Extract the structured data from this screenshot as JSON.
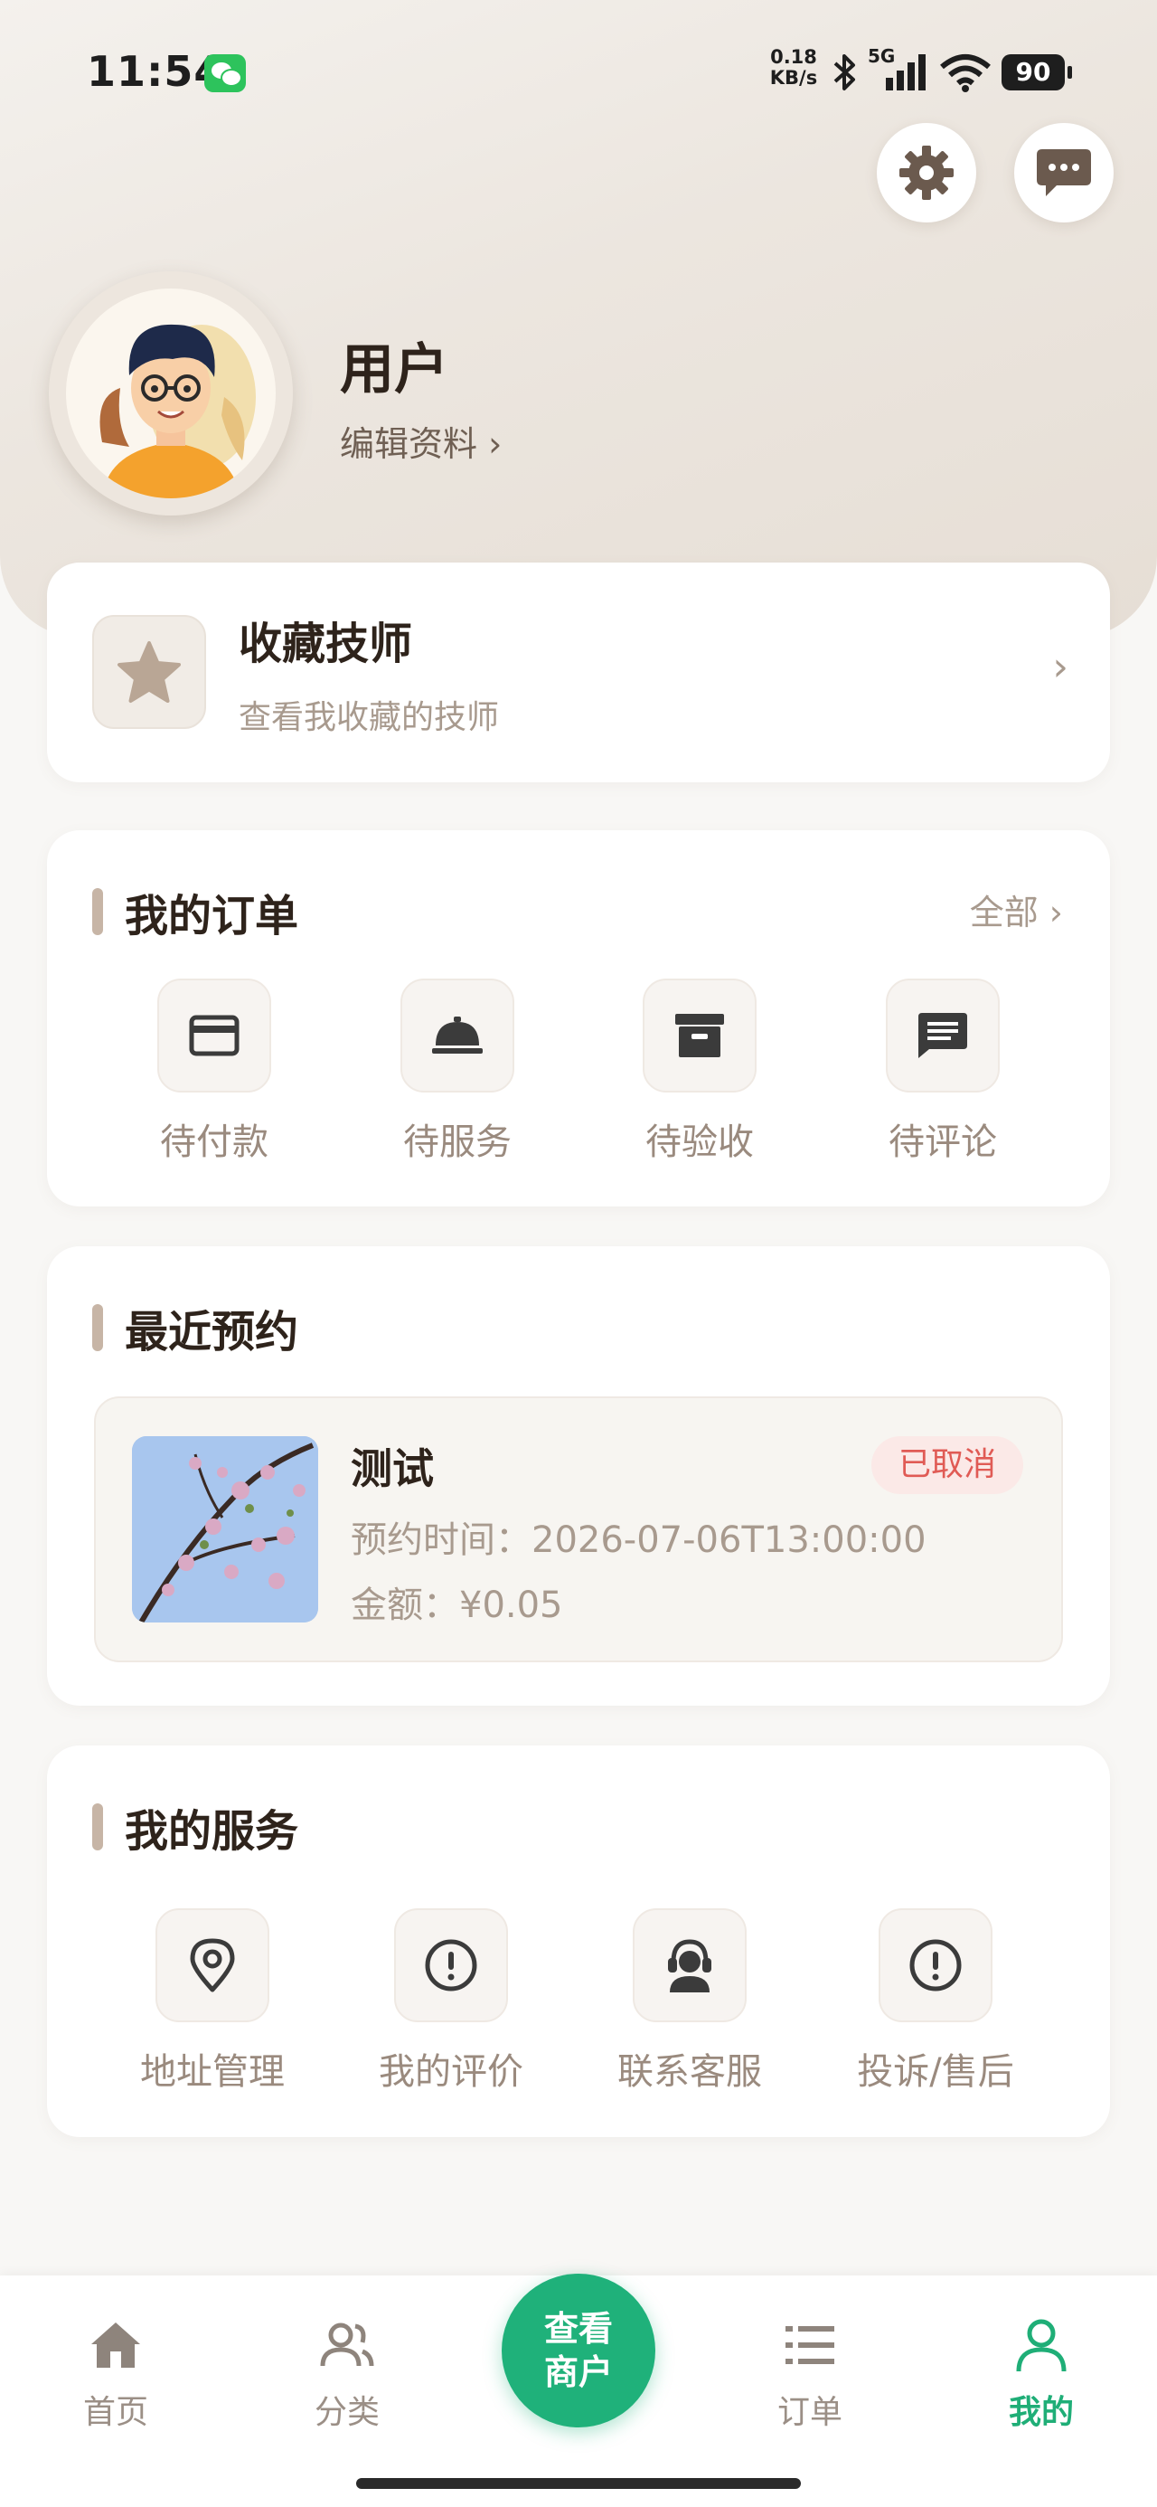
{
  "status_bar": {
    "time": "11:54",
    "net_speed_value": "0.18",
    "net_speed_unit": "KB/s",
    "network_type": "5G",
    "battery": "90"
  },
  "profile": {
    "username": "用户",
    "edit_label": "编辑资料 ›"
  },
  "favorites": {
    "title": "收藏技师",
    "subtitle": "查看我收藏的技师"
  },
  "orders": {
    "title": "我的订单",
    "all_label": "全部 ›",
    "items": [
      {
        "label": "待付款",
        "icon": "credit-card-icon"
      },
      {
        "label": "待服务",
        "icon": "service-bell-icon"
      },
      {
        "label": "待验收",
        "icon": "archive-box-icon"
      },
      {
        "label": "待评论",
        "icon": "comment-icon"
      }
    ]
  },
  "recent": {
    "title": "最近预约",
    "booking": {
      "name": "测试",
      "status": "已取消",
      "time": "预约时间：2026-07-06T13:00:00",
      "amount": "金额：¥0.05"
    }
  },
  "services": {
    "title": "我的服务",
    "items": [
      {
        "label": "地址管理",
        "icon": "location-pin-icon"
      },
      {
        "label": "我的评价",
        "icon": "alert-circle-icon"
      },
      {
        "label": "联系客服",
        "icon": "customer-service-icon"
      },
      {
        "label": "投诉/售后",
        "icon": "alert-circle-icon"
      }
    ]
  },
  "tabbar": {
    "items": [
      {
        "label": "首页",
        "icon": "home-icon"
      },
      {
        "label": "分类",
        "icon": "users-icon"
      },
      {
        "label": "订单",
        "icon": "list-icon"
      },
      {
        "label": "我的",
        "icon": "user-icon"
      }
    ],
    "center_line1": "查看",
    "center_line2": "商户",
    "active_index": 3
  },
  "colors": {
    "accent": "#1fb17a",
    "cancel_status": "#e05b55",
    "text_primary": "#2e231b",
    "text_muted": "#a89a8e",
    "section_bar": "#c7b5a6"
  }
}
